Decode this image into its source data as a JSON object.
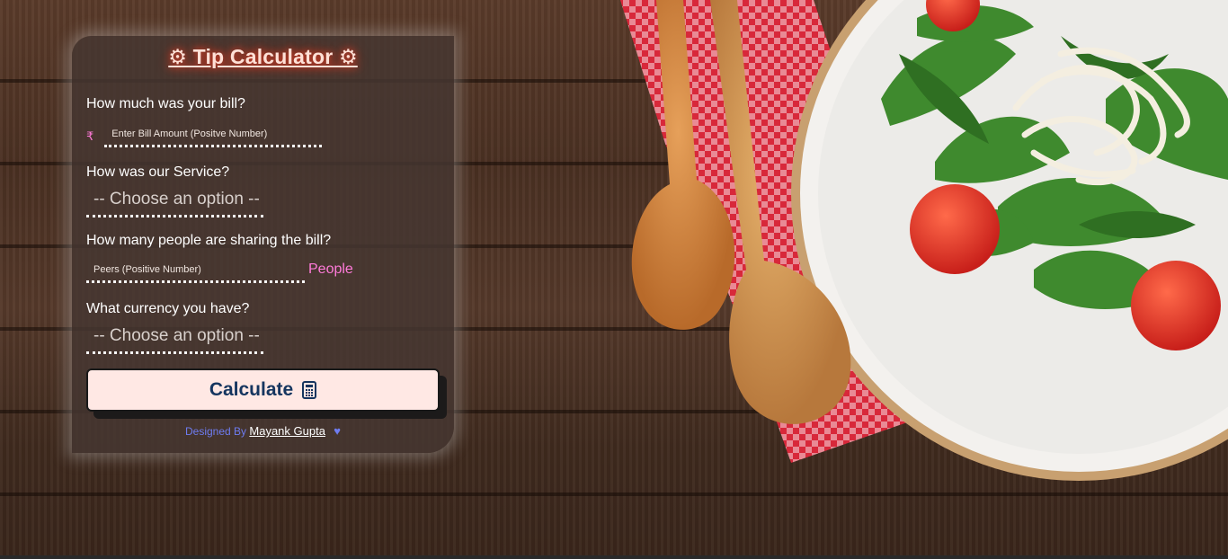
{
  "app": {
    "title": "⚙ Tip Calculator ⚙"
  },
  "form": {
    "bill_question": "How much was your bill?",
    "currency_symbol": "₹",
    "bill_placeholder": "Enter Bill Amount (Positve Number)",
    "bill_value": "",
    "service_question": "How was our Service?",
    "service_selected": "-- Choose an option --",
    "people_question": "How many people are sharing the bill?",
    "people_placeholder": "Peers (Positive Number)",
    "people_value": "",
    "people_suffix": "People",
    "currency_question": "What currency you have?",
    "currency_selected": "-- Choose an option --"
  },
  "actions": {
    "calculate_label": "Calculate",
    "calculate_icon": "calculator-icon"
  },
  "footer": {
    "designed_by": "Designed By",
    "author": "Mayank Gupta",
    "heart_icon": "heart-icon"
  },
  "colors": {
    "accent_pink": "#ff7ad9",
    "button_bg": "#ffe8e4",
    "button_text": "#15355f",
    "footer_blue": "#6e7cf0"
  }
}
